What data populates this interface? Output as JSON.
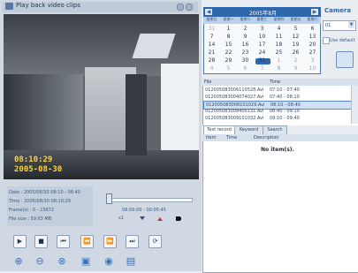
{
  "window": {
    "title": "Play back video clips"
  },
  "video": {
    "osd_time": "08:10:29",
    "osd_date": "2005-08-30"
  },
  "info": {
    "date": "Date : 2005/08/30 08:10 - 08:40",
    "time": "Time : 2005/08/30 08:10:29",
    "frames": "Frame(s) : 0 - 23872",
    "file_size": "File size : 59.63 MB"
  },
  "playback": {
    "range": "08:00:00 - 00:05:45",
    "speed": "x1"
  },
  "calendar": {
    "month_label": "2005年8月",
    "weekdays": [
      "星期日",
      "星期一",
      "星期二",
      "星期三",
      "星期四",
      "星期五",
      "星期六"
    ],
    "days": [
      [
        "31",
        "1",
        "2",
        "3",
        "4",
        "5",
        "6"
      ],
      [
        "7",
        "8",
        "9",
        "10",
        "11",
        "12",
        "13"
      ],
      [
        "14",
        "15",
        "16",
        "17",
        "18",
        "19",
        "20"
      ],
      [
        "21",
        "22",
        "23",
        "24",
        "25",
        "26",
        "27"
      ],
      [
        "28",
        "29",
        "30",
        "31",
        "1",
        "2",
        "3"
      ],
      [
        "4",
        "5",
        "6",
        "7",
        "8",
        "9",
        "10"
      ]
    ],
    "selected_day": "30"
  },
  "camera": {
    "title": "Camera",
    "selected": "01",
    "use_default_label": "Use default"
  },
  "files": {
    "headers": [
      "File",
      "Time"
    ],
    "rows": [
      {
        "name": "012005083006110528.Avi",
        "time": "07:10 - 07:40"
      },
      {
        "name": "012005083004074027.Avi",
        "time": "07:40 - 08:10"
      },
      {
        "name": "012005083008101029.Avi",
        "time": "08:10 - 08:40"
      },
      {
        "name": "012005083008400131.Avi",
        "time": "08:40 - 09:10"
      },
      {
        "name": "012005083009101032.Avi",
        "time": "09:10 - 09:40"
      }
    ],
    "selected_index": 2
  },
  "event_tabs": [
    "Text record",
    "Keyword",
    "Search"
  ],
  "event_table": {
    "headers": [
      "Item",
      "Time",
      "Description"
    ],
    "empty_text": "No item(s)."
  },
  "colors": {
    "accent": "#2f67ad",
    "osd": "#ffd43b"
  }
}
